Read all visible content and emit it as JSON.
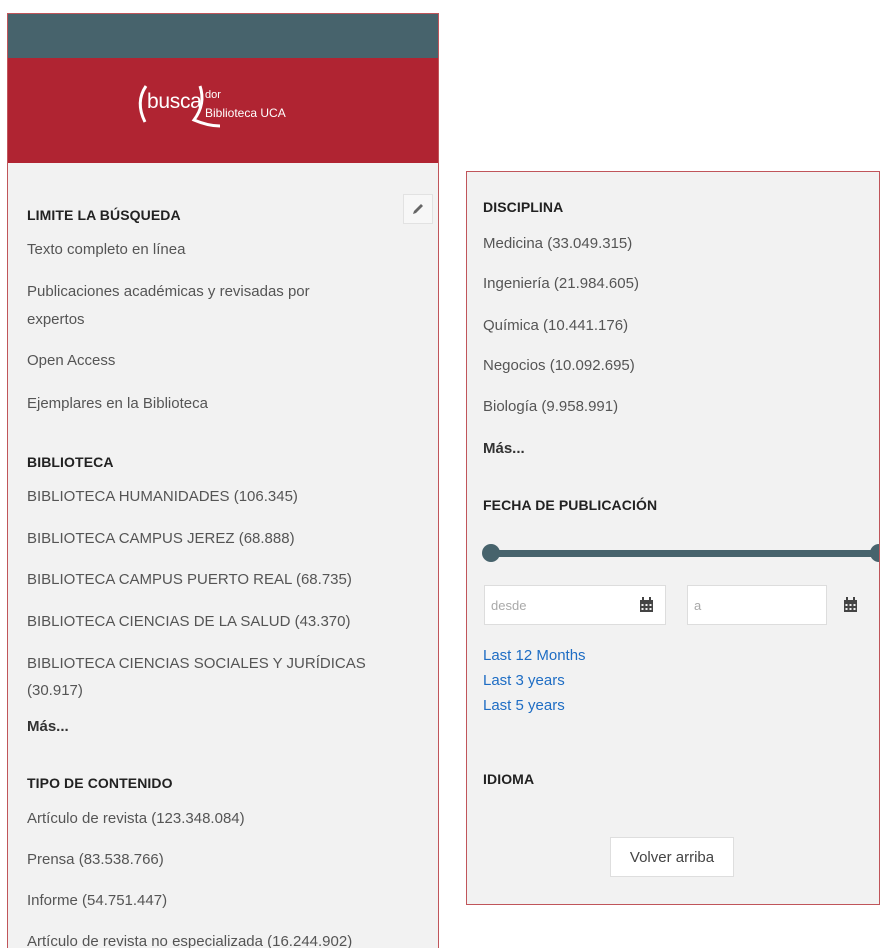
{
  "brand": {
    "logo_main": "busca",
    "logo_sup": "dor",
    "logo_sub": "Biblioteca UCA",
    "colors": {
      "topbar": "#47636c",
      "brand": "#b02432",
      "link": "#1e6dc4"
    }
  },
  "limit": {
    "title": "LIMITE LA BÚSQUEDA",
    "edit_icon": "pencil-icon",
    "items": [
      "Texto completo en línea",
      "Publicaciones académicas y revisadas por",
      "expertos",
      "Open Access",
      "Ejemplares en la Biblioteca"
    ]
  },
  "biblioteca": {
    "title": "BIBLIOTECA",
    "items": [
      "BIBLIOTECA HUMANIDADES (106.345)",
      "BIBLIOTECA CAMPUS JEREZ (68.888)",
      "BIBLIOTECA CAMPUS PUERTO REAL (68.735)",
      "BIBLIOTECA CIENCIAS DE LA SALUD (43.370)",
      "BIBLIOTECA CIENCIAS SOCIALES Y JURÍDICAS",
      "(30.917)"
    ],
    "more": "Más..."
  },
  "tipo": {
    "title": "TIPO DE CONTENIDO",
    "items": [
      "Artículo de revista (123.348.084)",
      "Prensa (83.538.766)",
      "Informe (54.751.447)",
      "Artículo de revista no especializada (16.244.902)"
    ]
  },
  "disciplina": {
    "title": "DISCIPLINA",
    "items": [
      "Medicina (33.049.315)",
      "Ingeniería (21.984.605)",
      "Química (10.441.176)",
      "Negocios (10.092.695)",
      "Biología (9.958.991)"
    ],
    "more": "Más..."
  },
  "fecha": {
    "title": "FECHA DE PUBLICACIÓN",
    "from_placeholder": "desde",
    "to_placeholder": "a",
    "calendar_icon": "calendar-icon",
    "quick_links": [
      "Last 12 Months",
      "Last 3 years",
      "Last 5 years"
    ]
  },
  "idioma": {
    "title": "IDIOMA"
  },
  "back_to_top": "Volver arriba"
}
